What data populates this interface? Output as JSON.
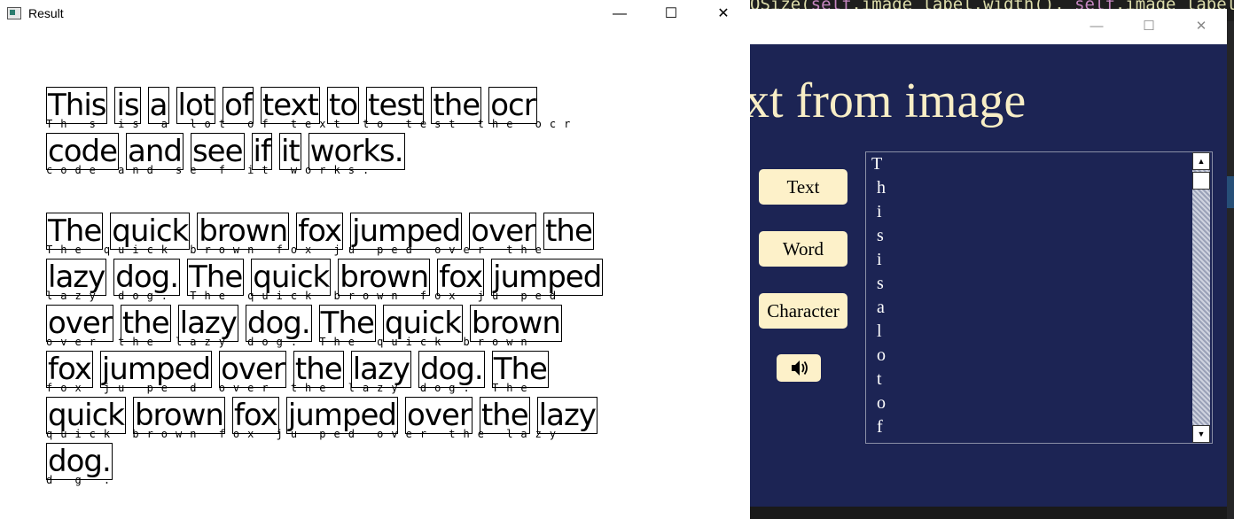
{
  "editor": {
    "code_pre": "QSize(",
    "kw1": "self",
    "code_mid": ".image_label.width(), ",
    "kw2": "self",
    "code_post": ".image_label.height())"
  },
  "result_window": {
    "title": "Result",
    "minimize": "—",
    "maximize": "☐",
    "close": "✕",
    "lines": [
      {
        "words": [
          "This",
          "is",
          "a",
          "lot",
          "of",
          "text",
          "to",
          "test",
          "the",
          "ocr"
        ],
        "sub": "Th s is a lot of text to test the ocr"
      },
      {
        "words": [
          "code",
          "and",
          "see",
          "if",
          "it",
          "works."
        ],
        "sub": "code and se f it works."
      },
      {
        "words": [
          "The",
          "quick",
          "brown",
          "fox",
          "jumped",
          "over",
          "the"
        ],
        "sub": "The quick brown fox ju ped over the"
      },
      {
        "words": [
          "lazy",
          "dog.",
          "The",
          "quick",
          "brown",
          "fox",
          "jumped"
        ],
        "sub": "lazy dog. The quick brown fox ju ped"
      },
      {
        "words": [
          "over",
          "the",
          "lazy",
          "dog.",
          "The",
          "quick",
          "brown"
        ],
        "sub": "over the lazy dog. The quick brown"
      },
      {
        "words": [
          "fox",
          "jumped",
          "over",
          "the",
          "lazy",
          "dog.",
          "The"
        ],
        "sub": "fox ju pe d over the lazy dog. The"
      },
      {
        "words": [
          "quick",
          "brown",
          "fox",
          "jumped",
          "over",
          "the",
          "lazy"
        ],
        "sub": "quick brown fox ju ped over the lazy"
      },
      {
        "words": [
          "dog."
        ],
        "sub": "d g ."
      }
    ]
  },
  "app_window": {
    "heading": "xt from image",
    "buttons": {
      "text": "Text",
      "word": "Word",
      "character": "Character"
    },
    "speaker_icon": "speaker-icon",
    "output_chars": [
      "T",
      "h",
      "i",
      "s",
      "i",
      "s",
      "a",
      "l",
      "o",
      "t",
      "o",
      "f"
    ],
    "scroll_up": "▲",
    "scroll_down": "▼"
  }
}
